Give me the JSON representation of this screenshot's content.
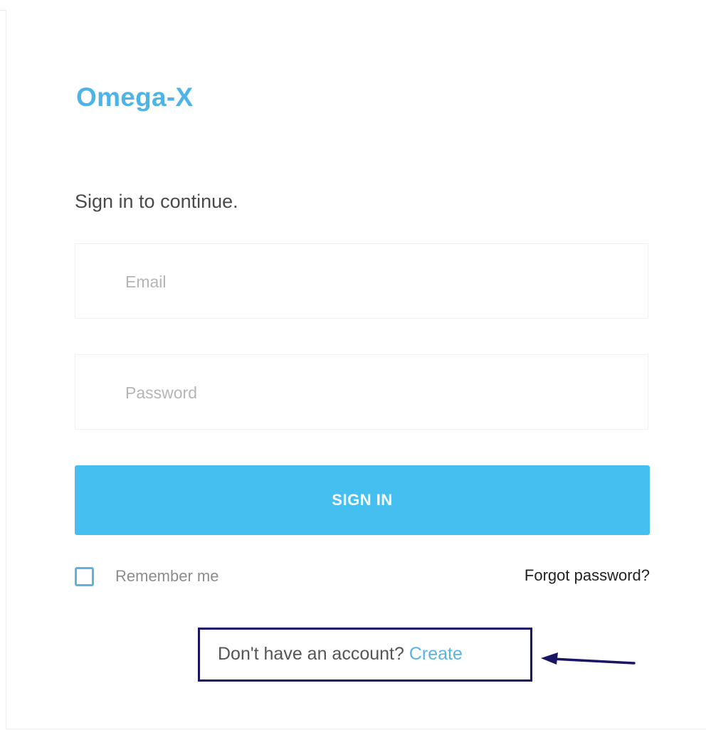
{
  "browser": {
    "snippet_text": "",
    "snippet_link": ""
  },
  "login": {
    "brand_title": "Omega-X",
    "subtitle": "Sign in to continue.",
    "email_placeholder": "Email",
    "password_placeholder": "Password",
    "signin_label": "SIGN IN",
    "remember_label": "Remember me",
    "forgot_label": "Forgot password?",
    "account_prompt": "Don't have an account?",
    "create_label": "Create"
  },
  "colors": {
    "brand": "#4cb4e6",
    "button": "#45bff0",
    "callout_border": "#1a1464",
    "arrow": "#1a1464"
  },
  "icons": {
    "arrow": "left-arrow-icon",
    "checkbox": "checkbox-icon"
  }
}
